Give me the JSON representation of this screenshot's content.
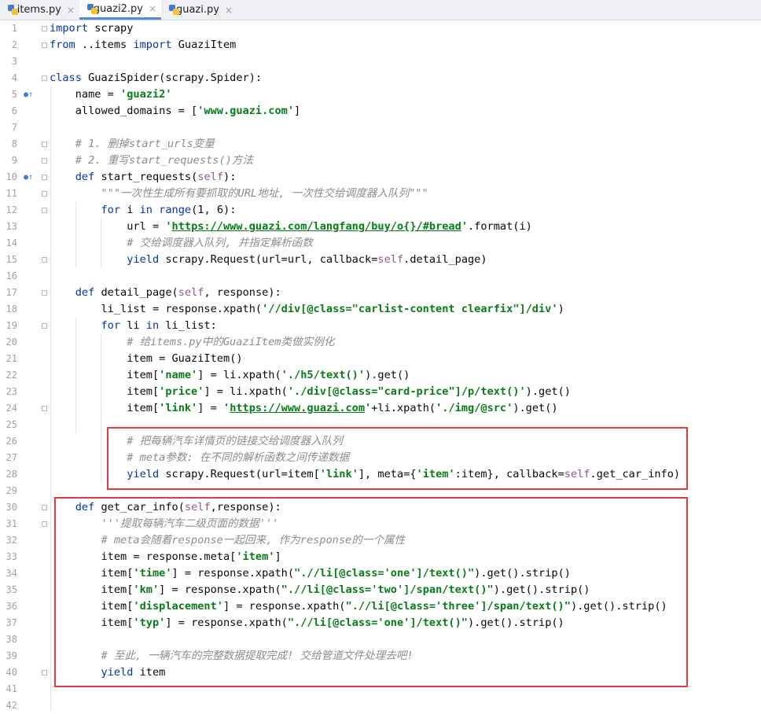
{
  "tabs": [
    {
      "label": "items.py",
      "close": "×",
      "active": false
    },
    {
      "label": "guazi2.py",
      "close": "×",
      "active": true
    },
    {
      "label": "guazi.py",
      "close": "×",
      "active": false
    }
  ],
  "lines": [
    [
      {
        "t": "import ",
        "c": "kw"
      },
      {
        "t": "scrapy"
      }
    ],
    [
      {
        "t": "from ",
        "c": "kw"
      },
      {
        "t": "..items "
      },
      {
        "t": "import ",
        "c": "kw"
      },
      {
        "t": "GuaziItem"
      }
    ],
    [],
    [
      {
        "t": "class ",
        "c": "kw"
      },
      {
        "t": "GuaziSpider(scrapy.Spider):"
      }
    ],
    [
      {
        "t": "    name = "
      },
      {
        "t": "'guazi2'",
        "c": "str"
      }
    ],
    [
      {
        "t": "    allowed_domains = ["
      },
      {
        "t": "'www.guazi.com'",
        "c": "str"
      },
      {
        "t": "]"
      }
    ],
    [],
    [
      {
        "t": "    # 1. 删掉start_urls变量",
        "c": "cmt"
      }
    ],
    [
      {
        "t": "    # 2. 重写start_requests()方法",
        "c": "cmt"
      }
    ],
    [
      {
        "t": "    "
      },
      {
        "t": "def ",
        "c": "kw"
      },
      {
        "t": "start_requests("
      },
      {
        "t": "self",
        "c": "self"
      },
      {
        "t": "):"
      }
    ],
    [
      {
        "t": "        \"\"\"一次性生成所有要抓取的URL地址, 一次性交给调度器入队列\"\"\"",
        "c": "cmt"
      }
    ],
    [
      {
        "t": "        "
      },
      {
        "t": "for ",
        "c": "kw"
      },
      {
        "t": "i "
      },
      {
        "t": "in ",
        "c": "kw"
      },
      {
        "t": "range",
        "c": "kw"
      },
      {
        "t": "(1, 6):"
      }
    ],
    [
      {
        "t": "            url = "
      },
      {
        "t": "'",
        "c": "str"
      },
      {
        "t": "https://www.guazi.com/langfang/buy/o{}/#bread",
        "c": "url"
      },
      {
        "t": "'",
        "c": "str"
      },
      {
        "t": ".format(i)"
      }
    ],
    [
      {
        "t": "            # 交给调度器入队列, 并指定解析函数",
        "c": "cmt"
      }
    ],
    [
      {
        "t": "            "
      },
      {
        "t": "yield ",
        "c": "kw"
      },
      {
        "t": "scrapy.Request(url=url, callback="
      },
      {
        "t": "self",
        "c": "self"
      },
      {
        "t": ".detail_page)"
      }
    ],
    [],
    [
      {
        "t": "    "
      },
      {
        "t": "def ",
        "c": "kw"
      },
      {
        "t": "detail_page("
      },
      {
        "t": "self",
        "c": "self"
      },
      {
        "t": ", response):"
      }
    ],
    [
      {
        "t": "        li_list = response.xpath("
      },
      {
        "t": "'//div[@class=\"carlist-content clearfix\"]/div'",
        "c": "str"
      },
      {
        "t": ")"
      }
    ],
    [
      {
        "t": "        "
      },
      {
        "t": "for ",
        "c": "kw"
      },
      {
        "t": "li "
      },
      {
        "t": "in ",
        "c": "kw"
      },
      {
        "t": "li_list:"
      }
    ],
    [
      {
        "t": "            # 给items.py中的GuaziItem类做实例化",
        "c": "cmt"
      }
    ],
    [
      {
        "t": "            item = GuaziItem()"
      }
    ],
    [
      {
        "t": "            item["
      },
      {
        "t": "'name'",
        "c": "str"
      },
      {
        "t": "] = li.xpath("
      },
      {
        "t": "'./h5/text()'",
        "c": "str"
      },
      {
        "t": ").get()"
      }
    ],
    [
      {
        "t": "            item["
      },
      {
        "t": "'price'",
        "c": "str"
      },
      {
        "t": "] = li.xpath("
      },
      {
        "t": "'./div[@class=\"card-price\"]/p/text()'",
        "c": "str"
      },
      {
        "t": ").get()"
      }
    ],
    [
      {
        "t": "            item["
      },
      {
        "t": "'link'",
        "c": "str"
      },
      {
        "t": "] = "
      },
      {
        "t": "'",
        "c": "str"
      },
      {
        "t": "https://www.guazi.com",
        "c": "url"
      },
      {
        "t": "'",
        "c": "str"
      },
      {
        "t": "+li.xpath("
      },
      {
        "t": "'./img/@src'",
        "c": "str"
      },
      {
        "t": ").get()"
      }
    ],
    [],
    [
      {
        "t": "            # 把每辆汽车详情页的链接交给调度器入队列",
        "c": "cmt"
      }
    ],
    [
      {
        "t": "            # meta参数: 在不同的解析函数之间传递数据",
        "c": "cmt"
      }
    ],
    [
      {
        "t": "            "
      },
      {
        "t": "yield ",
        "c": "kw"
      },
      {
        "t": "scrapy.Request(url=item["
      },
      {
        "t": "'link'",
        "c": "str"
      },
      {
        "t": "], meta={"
      },
      {
        "t": "'item'",
        "c": "str"
      },
      {
        "t": ":item}, callback="
      },
      {
        "t": "self",
        "c": "self"
      },
      {
        "t": ".get_car_info)"
      }
    ],
    [],
    [
      {
        "t": "    "
      },
      {
        "t": "def ",
        "c": "kw"
      },
      {
        "t": "get_car_info("
      },
      {
        "t": "self",
        "c": "self"
      },
      {
        "t": ",response):"
      }
    ],
    [
      {
        "t": "        '''提取每辆汽车二级页面的数据'''",
        "c": "cmt"
      }
    ],
    [
      {
        "t": "        # meta会随着response一起回来, 作为response的一个属性",
        "c": "cmt"
      }
    ],
    [
      {
        "t": "        item = response.meta["
      },
      {
        "t": "'item'",
        "c": "str"
      },
      {
        "t": "]"
      }
    ],
    [
      {
        "t": "        item["
      },
      {
        "t": "'time'",
        "c": "str"
      },
      {
        "t": "] = response.xpath("
      },
      {
        "t": "\".//li[@class='one']/text()\"",
        "c": "str"
      },
      {
        "t": ").get().strip()"
      }
    ],
    [
      {
        "t": "        item["
      },
      {
        "t": "'km'",
        "c": "str"
      },
      {
        "t": "] = response.xpath("
      },
      {
        "t": "\".//li[@class='two']/span/text()\"",
        "c": "str"
      },
      {
        "t": ").get().strip()"
      }
    ],
    [
      {
        "t": "        item["
      },
      {
        "t": "'displacement'",
        "c": "str"
      },
      {
        "t": "] = response.xpath("
      },
      {
        "t": "\".//li[@class='three']/span/text()\"",
        "c": "str"
      },
      {
        "t": ").get().strip()"
      }
    ],
    [
      {
        "t": "        item["
      },
      {
        "t": "'typ'",
        "c": "str"
      },
      {
        "t": "] = response.xpath("
      },
      {
        "t": "\".//li[@class='one']/text()\"",
        "c": "str"
      },
      {
        "t": ").get().strip()"
      }
    ],
    [],
    [
      {
        "t": "        # 至此, 一辆汽车的完整数据提取完成! 交给管道文件处理去吧!",
        "c": "cmt"
      }
    ],
    [
      {
        "t": "        "
      },
      {
        "t": "yield ",
        "c": "kw"
      },
      {
        "t": "item"
      }
    ],
    [],
    []
  ],
  "colors": {
    "highlight_box": "#e63b3b",
    "keyword": "#0033b3",
    "string": "#067d17",
    "comment": "#8c8c8c"
  }
}
